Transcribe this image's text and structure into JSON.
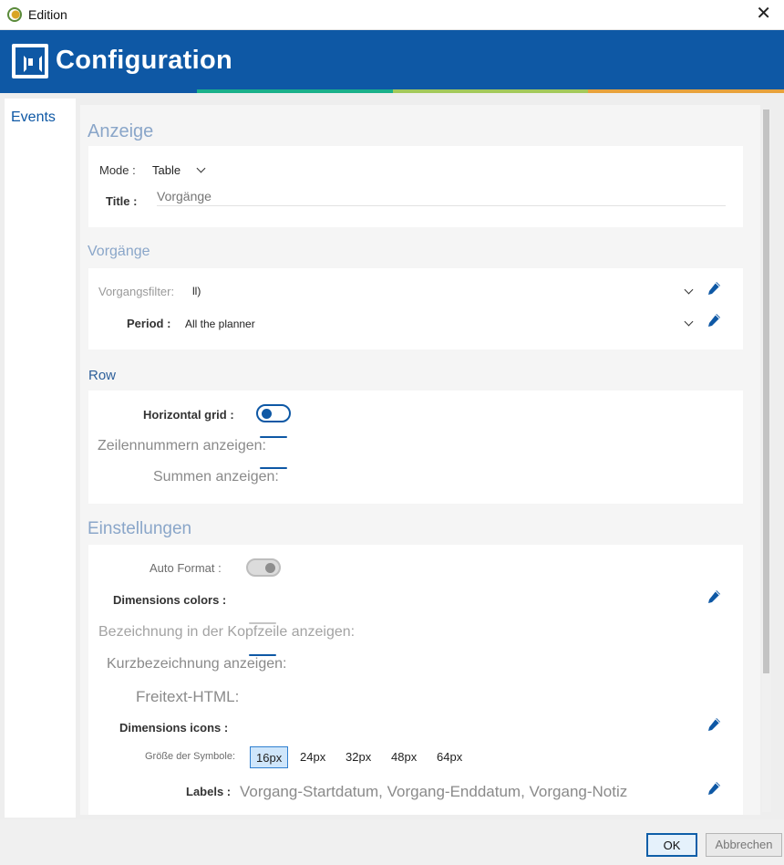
{
  "window": {
    "title": "Edition",
    "close_glyph": "✕"
  },
  "header": {
    "title": "Configuration"
  },
  "sidebar": {
    "items": [
      {
        "label": "Events"
      }
    ]
  },
  "anzeige": {
    "section_title": "Anzeige",
    "mode_label": "Mode :",
    "mode_value": "Table",
    "title_label": "Title :",
    "title_placeholder": "Vorgänge"
  },
  "vorgaenge": {
    "section_title": "Vorgänge",
    "filter_label": "Vorgangsfilter:",
    "filter_value": "ll)",
    "period_label": "Period :",
    "period_value": "All the planner"
  },
  "row": {
    "section_title": "Row",
    "horizontal_grid_label": "Horizontal grid :",
    "horizontal_grid_on": true,
    "line_numbers_label": "Zeilennummern anzeigen:",
    "sums_label": "Summen anzeigen:"
  },
  "einstellungen": {
    "section_title": "Einstellungen",
    "auto_format_label": "Auto Format :",
    "auto_format_on": true,
    "auto_format_disabled": true,
    "dimension_colors_label": "Dimensions colors :",
    "header_label_label": "Bezeichnung in der Kopfzeile anzeigen:",
    "short_label_label": "Kurzbezeichnung anzeigen:",
    "freetext_label": "Freitext-HTML:",
    "dimension_icons_label": "Dimensions icons :",
    "icon_size_label": "Größe der Symbole:",
    "icon_sizes": [
      "16px",
      "24px",
      "32px",
      "48px",
      "64px"
    ],
    "icon_size_selected": "16px",
    "labels_label": "Labels :",
    "labels_value": "Vorgang-Startdatum, Vorgang-Enddatum, Vorgang-Notiz"
  },
  "footer": {
    "ok_label": "OK",
    "cancel_label": "Abbrechen"
  },
  "colors": {
    "brand_blue": "#0e58a5",
    "stripe_green": "#1ab08a",
    "stripe_lime": "#a3c95b",
    "stripe_orange": "#e8a23c",
    "section_title": "#8aa6c9"
  },
  "icons": {
    "app": "app-logo-icon",
    "close": "close-icon",
    "header": "configuration-logo-icon",
    "dropdown": "chevron-down-icon",
    "edit": "pencil-icon"
  }
}
